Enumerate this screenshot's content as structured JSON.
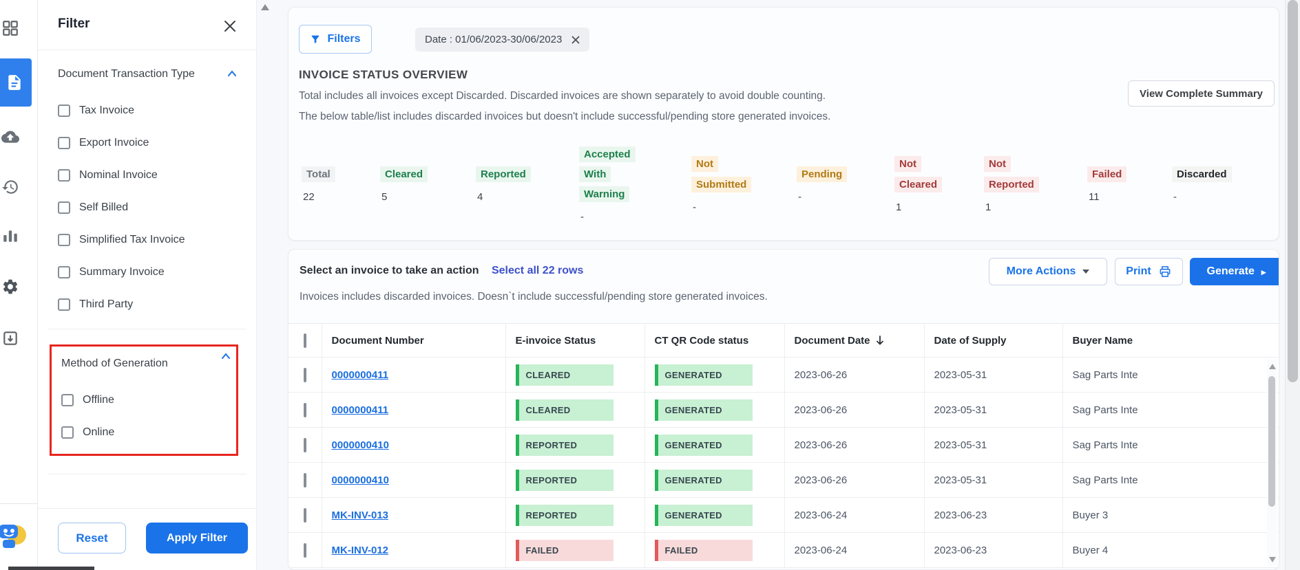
{
  "colors": {
    "accent": "#1a73e8",
    "highlight_box": "#e8251f",
    "badge_green": "#27b45a",
    "badge_red": "#e15b5b",
    "link_indigo": "#3d51c9"
  },
  "sidebar": {
    "icons": [
      "dashboard",
      "documents",
      "upload",
      "history",
      "analytics",
      "settings",
      "archive"
    ],
    "active_icon": "documents"
  },
  "filter_panel": {
    "title": "Filter",
    "sections": [
      {
        "title": "Document Transaction Type",
        "highlighted": false,
        "items": [
          "Tax Invoice",
          "Export Invoice",
          "Nominal Invoice",
          "Self Billed",
          "Simplified Tax Invoice",
          "Summary Invoice",
          "Third Party"
        ]
      },
      {
        "title": "Method of Generation",
        "highlighted": true,
        "items": [
          "Offline",
          "Online"
        ]
      }
    ],
    "reset_label": "Reset",
    "apply_label": "Apply Filter"
  },
  "toolbar": {
    "filters_label": "Filters",
    "date_chip": "Date : 01/06/2023-30/06/2023"
  },
  "overview": {
    "title": "INVOICE STATUS OVERVIEW",
    "description_line1": "Total includes all invoices except Discarded. Discarded invoices are shown separately to avoid double counting.",
    "description_line2": "The below table/list includes discarded invoices but doesn't include successful/pending store generated invoices.",
    "view_summary_label": "View Complete Summary",
    "statuses": [
      {
        "label": "Total",
        "value": "22",
        "tone": "neutral"
      },
      {
        "label": "Cleared",
        "value": "5",
        "tone": "green"
      },
      {
        "label": "Reported",
        "value": "4",
        "tone": "green"
      },
      {
        "label": "Accepted With Warning",
        "value": "-",
        "tone": "green"
      },
      {
        "label": "Not Submitted",
        "value": "-",
        "tone": "amber"
      },
      {
        "label": "Pending",
        "value": "-",
        "tone": "amber"
      },
      {
        "label": "Not Cleared",
        "value": "1",
        "tone": "red"
      },
      {
        "label": "Not Reported",
        "value": "1",
        "tone": "red"
      },
      {
        "label": "Failed",
        "value": "11",
        "tone": "red"
      },
      {
        "label": "Discarded",
        "value": "-",
        "tone": "dark"
      }
    ]
  },
  "actions": {
    "select_prompt": "Select an invoice to take an action",
    "select_all_label": "Select all 22 rows",
    "note": "Invoices includes discarded invoices. Doesn`t include successful/pending store generated invoices.",
    "more_actions_label": "More Actions",
    "print_label": "Print",
    "generate_label": "Generate"
  },
  "table": {
    "columns": [
      {
        "label": "Document Number",
        "sorted": false
      },
      {
        "label": "E-invoice Status",
        "sorted": false
      },
      {
        "label": "CT QR Code status",
        "sorted": false
      },
      {
        "label": "Document Date",
        "sorted": true
      },
      {
        "label": "Date of Supply",
        "sorted": false
      },
      {
        "label": "Buyer Name",
        "sorted": false
      }
    ],
    "rows": [
      {
        "document_number": "0000000411",
        "e_invoice_status": "CLEARED",
        "e_invoice_tone": "green",
        "qr_status": "GENERATED",
        "qr_tone": "green",
        "document_date": "2023-06-26",
        "date_of_supply": "2023-05-31",
        "buyer_name": "Sag Parts Inte"
      },
      {
        "document_number": "0000000411",
        "e_invoice_status": "CLEARED",
        "e_invoice_tone": "green",
        "qr_status": "GENERATED",
        "qr_tone": "green",
        "document_date": "2023-06-26",
        "date_of_supply": "2023-05-31",
        "buyer_name": "Sag Parts Inte"
      },
      {
        "document_number": "0000000410",
        "e_invoice_status": "REPORTED",
        "e_invoice_tone": "green",
        "qr_status": "GENERATED",
        "qr_tone": "green",
        "document_date": "2023-06-26",
        "date_of_supply": "2023-05-31",
        "buyer_name": "Sag Parts Inte"
      },
      {
        "document_number": "0000000410",
        "e_invoice_status": "REPORTED",
        "e_invoice_tone": "green",
        "qr_status": "GENERATED",
        "qr_tone": "green",
        "document_date": "2023-06-26",
        "date_of_supply": "2023-05-31",
        "buyer_name": "Sag Parts Inte"
      },
      {
        "document_number": "MK-INV-013",
        "e_invoice_status": "REPORTED",
        "e_invoice_tone": "green",
        "qr_status": "GENERATED",
        "qr_tone": "green",
        "document_date": "2023-06-24",
        "date_of_supply": "2023-06-23",
        "buyer_name": "Buyer 3"
      },
      {
        "document_number": "MK-INV-012",
        "e_invoice_status": "FAILED",
        "e_invoice_tone": "red",
        "qr_status": "FAILED",
        "qr_tone": "red",
        "document_date": "2023-06-24",
        "date_of_supply": "2023-06-23",
        "buyer_name": "Buyer 4"
      }
    ]
  }
}
